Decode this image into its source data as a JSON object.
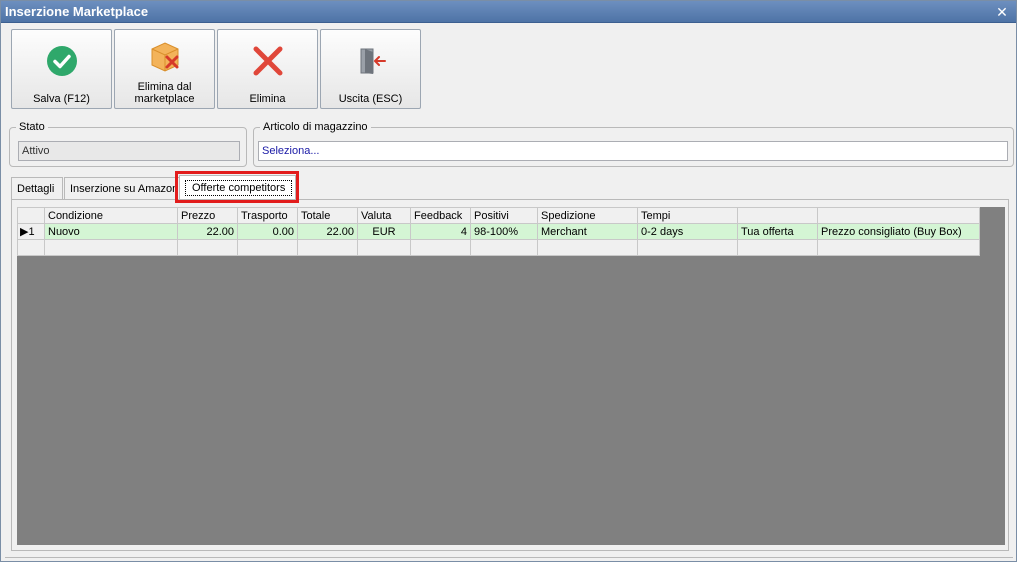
{
  "window": {
    "title": "Inserzione Marketplace"
  },
  "toolbar": {
    "save_label": "Salva (F12)",
    "remove_marketplace_label": "Elimina dal marketplace",
    "delete_label": "Elimina",
    "exit_label": "Uscita (ESC)"
  },
  "status_group": {
    "legend": "Stato",
    "value": "Attivo"
  },
  "article_group": {
    "legend": "Articolo di magazzino",
    "value": "Seleziona..."
  },
  "tabs": [
    {
      "label": "Dettagli"
    },
    {
      "label": "Inserzione su Amazon"
    },
    {
      "label": "Offerte competitors"
    }
  ],
  "grid": {
    "columns": [
      "Condizione",
      "Prezzo",
      "Trasporto",
      "Totale",
      "Valuta",
      "Feedback",
      "Positivi",
      "Spedizione",
      "Tempi",
      "",
      ""
    ],
    "rows": [
      {
        "indicator": "1",
        "cells": [
          "Nuovo",
          "22.00",
          "0.00",
          "22.00",
          "EUR",
          "4",
          "98-100%",
          "Merchant",
          "0-2 days",
          "Tua offerta",
          "Prezzo consigliato (Buy Box)"
        ]
      }
    ]
  },
  "colors": {
    "accent_highlight": "#e21c1c",
    "selected_row": "#d4f5d4",
    "titlebar": "#4e73a6"
  }
}
